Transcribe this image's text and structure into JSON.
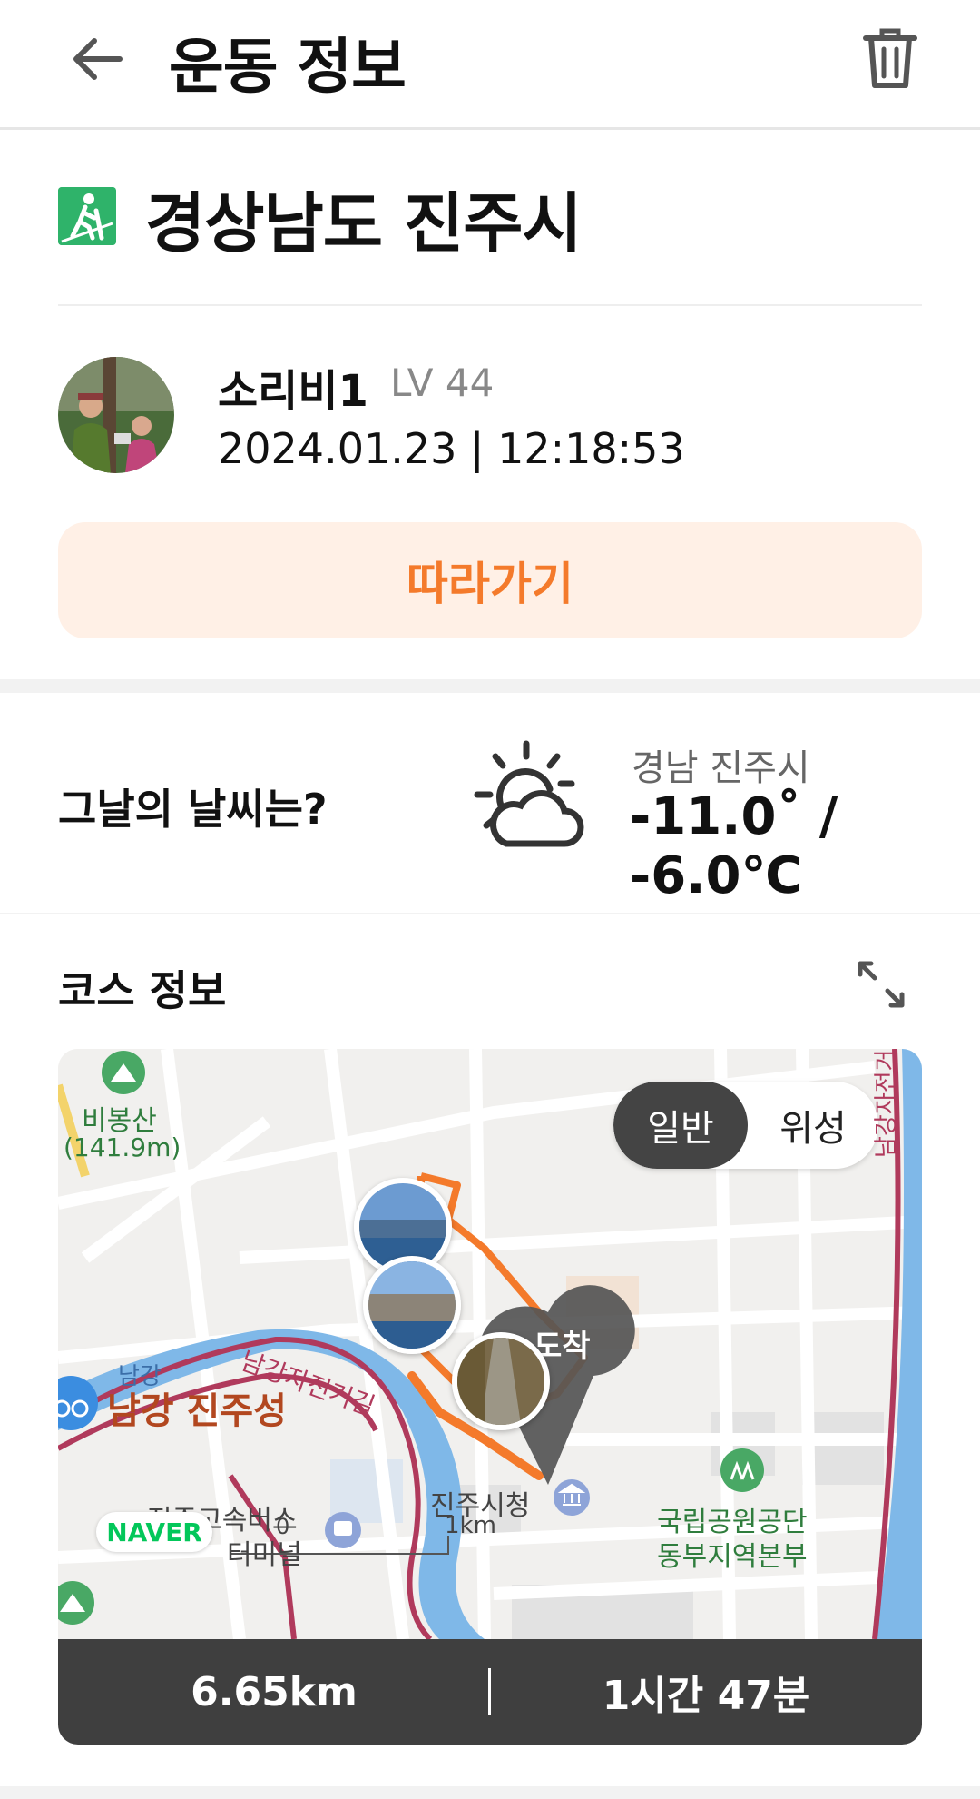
{
  "header": {
    "title": "운동 정보"
  },
  "activity": {
    "location": "경상남도 진주시",
    "user_name": "소리비1",
    "user_level": "LV 44",
    "datetime": "2024.01.23 | 12:18:53",
    "follow_label": "따라가기"
  },
  "weather": {
    "question": "그날의 날씨는?",
    "location": "경남 진주시",
    "temperature": "-11.0˚ / -6.0℃"
  },
  "course": {
    "title": "코스 정보",
    "map_toggle": {
      "normal": "일반",
      "satellite": "위성"
    },
    "map_labels": {
      "mountain": "비봉산",
      "mountain_height": "(141.9m)",
      "river_small": "남강",
      "fortress": "남강 진주성",
      "bike_path": "남강자전거길",
      "bike_path_right": "남강자전거",
      "city_hall": "진주시청",
      "bus_terminal_line1": "진주고속버스",
      "bus_terminal_line2": "터미널",
      "park_office_line1": "국립공원공단",
      "park_office_line2": "동부지역본부",
      "finish": "도착",
      "scale_zero": "0",
      "scale_km": "1km",
      "naver": "NAVER"
    },
    "stats": {
      "distance": "6.65km",
      "duration": "1시간 47분"
    }
  },
  "colors": {
    "accent": "#f47a2b",
    "accent_bg": "#fff0e6",
    "hike_icon": "#2fb36a",
    "stat_bar": "#3f3f3f"
  }
}
